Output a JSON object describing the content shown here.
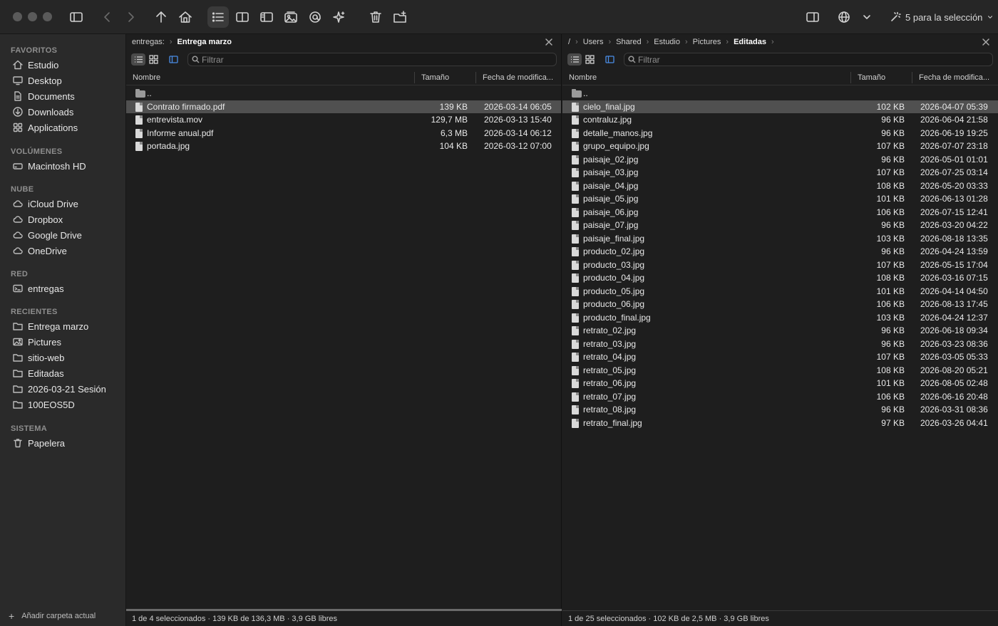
{
  "toolbar": {
    "selection_label": "5 para la selección"
  },
  "sidebar": {
    "sections": [
      {
        "title": "FAVORITOS",
        "items": [
          {
            "label": "Estudio",
            "icon": "home-icon"
          },
          {
            "label": "Desktop",
            "icon": "desktop-icon"
          },
          {
            "label": "Documents",
            "icon": "document-icon"
          },
          {
            "label": "Downloads",
            "icon": "download-icon"
          },
          {
            "label": "Applications",
            "icon": "applications-icon"
          }
        ]
      },
      {
        "title": "VOLÚMENES",
        "items": [
          {
            "label": "Macintosh HD",
            "icon": "disk-icon"
          }
        ]
      },
      {
        "title": "NUBE",
        "items": [
          {
            "label": "iCloud Drive",
            "icon": "cloud-icon"
          },
          {
            "label": "Dropbox",
            "icon": "cloud-icon"
          },
          {
            "label": "Google Drive",
            "icon": "cloud-icon"
          },
          {
            "label": "OneDrive",
            "icon": "cloud-icon"
          }
        ]
      },
      {
        "title": "RED",
        "items": [
          {
            "label": "entregas",
            "icon": "network-drive-icon"
          }
        ]
      },
      {
        "title": "RECIENTES",
        "items": [
          {
            "label": "Entrega marzo",
            "icon": "folder-icon"
          },
          {
            "label": "Pictures",
            "icon": "pictures-icon"
          },
          {
            "label": "sitio-web",
            "icon": "folder-icon"
          },
          {
            "label": "Editadas",
            "icon": "folder-icon"
          },
          {
            "label": "2026-03-21 Sesión",
            "icon": "folder-icon"
          },
          {
            "label": "100EOS5D",
            "icon": "folder-icon"
          }
        ]
      },
      {
        "title": "SISTEMA",
        "items": [
          {
            "label": "Papelera",
            "icon": "trash-icon"
          }
        ]
      }
    ],
    "footer_label": "Añadir carpeta actual"
  },
  "left_pane": {
    "breadcrumb": [
      "entregas:",
      "Entrega marzo"
    ],
    "filter_placeholder": "Filtrar",
    "columns": {
      "name": "Nombre",
      "size": "Tamaño",
      "date": "Fecha de modifica..."
    },
    "parent_label": "..",
    "files": [
      {
        "name": "Contrato firmado.pdf",
        "size": "139 KB",
        "date": "2026-03-14 06:05",
        "selected": true
      },
      {
        "name": "entrevista.mov",
        "size": "129,7 MB",
        "date": "2026-03-13 15:40",
        "selected": false
      },
      {
        "name": "Informe anual.pdf",
        "size": "6,3 MB",
        "date": "2026-03-14 06:12",
        "selected": false
      },
      {
        "name": "portada.jpg",
        "size": "104 KB",
        "date": "2026-03-12 07:00",
        "selected": false
      }
    ],
    "status": "1 de 4 seleccionados · 139 KB de 136,3 MB · 3,9 GB libres"
  },
  "right_pane": {
    "breadcrumb": [
      "/",
      "Users",
      "Shared",
      "Estudio",
      "Pictures",
      "Editadas"
    ],
    "filter_placeholder": "Filtrar",
    "columns": {
      "name": "Nombre",
      "size": "Tamaño",
      "date": "Fecha de modifica..."
    },
    "parent_label": "..",
    "files": [
      {
        "name": "cielo_final.jpg",
        "size": "102 KB",
        "date": "2026-04-07 05:39",
        "selected": true
      },
      {
        "name": "contraluz.jpg",
        "size": "96 KB",
        "date": "2026-06-04 21:58",
        "selected": false
      },
      {
        "name": "detalle_manos.jpg",
        "size": "96 KB",
        "date": "2026-06-19 19:25",
        "selected": false
      },
      {
        "name": "grupo_equipo.jpg",
        "size": "107 KB",
        "date": "2026-07-07 23:18",
        "selected": false
      },
      {
        "name": "paisaje_02.jpg",
        "size": "96 KB",
        "date": "2026-05-01 01:01",
        "selected": false
      },
      {
        "name": "paisaje_03.jpg",
        "size": "107 KB",
        "date": "2026-07-25 03:14",
        "selected": false
      },
      {
        "name": "paisaje_04.jpg",
        "size": "108 KB",
        "date": "2026-05-20 03:33",
        "selected": false
      },
      {
        "name": "paisaje_05.jpg",
        "size": "101 KB",
        "date": "2026-06-13 01:28",
        "selected": false
      },
      {
        "name": "paisaje_06.jpg",
        "size": "106 KB",
        "date": "2026-07-15 12:41",
        "selected": false
      },
      {
        "name": "paisaje_07.jpg",
        "size": "96 KB",
        "date": "2026-03-20 04:22",
        "selected": false
      },
      {
        "name": "paisaje_final.jpg",
        "size": "103 KB",
        "date": "2026-08-18 13:35",
        "selected": false
      },
      {
        "name": "producto_02.jpg",
        "size": "96 KB",
        "date": "2026-04-24 13:59",
        "selected": false
      },
      {
        "name": "producto_03.jpg",
        "size": "107 KB",
        "date": "2026-05-15 17:04",
        "selected": false
      },
      {
        "name": "producto_04.jpg",
        "size": "108 KB",
        "date": "2026-03-16 07:15",
        "selected": false
      },
      {
        "name": "producto_05.jpg",
        "size": "101 KB",
        "date": "2026-04-14 04:50",
        "selected": false
      },
      {
        "name": "producto_06.jpg",
        "size": "106 KB",
        "date": "2026-08-13 17:45",
        "selected": false
      },
      {
        "name": "producto_final.jpg",
        "size": "103 KB",
        "date": "2026-04-24 12:37",
        "selected": false
      },
      {
        "name": "retrato_02.jpg",
        "size": "96 KB",
        "date": "2026-06-18 09:34",
        "selected": false
      },
      {
        "name": "retrato_03.jpg",
        "size": "96 KB",
        "date": "2026-03-23 08:36",
        "selected": false
      },
      {
        "name": "retrato_04.jpg",
        "size": "107 KB",
        "date": "2026-03-05 05:33",
        "selected": false
      },
      {
        "name": "retrato_05.jpg",
        "size": "108 KB",
        "date": "2026-08-20 05:21",
        "selected": false
      },
      {
        "name": "retrato_06.jpg",
        "size": "101 KB",
        "date": "2026-08-05 02:48",
        "selected": false
      },
      {
        "name": "retrato_07.jpg",
        "size": "106 KB",
        "date": "2026-06-16 20:48",
        "selected": false
      },
      {
        "name": "retrato_08.jpg",
        "size": "96 KB",
        "date": "2026-03-31 08:36",
        "selected": false
      },
      {
        "name": "retrato_final.jpg",
        "size": "97 KB",
        "date": "2026-03-26 04:41",
        "selected": false
      }
    ],
    "status": "1 de 25 seleccionados · 102 KB de 2,5 MB · 3,9 GB libres"
  }
}
